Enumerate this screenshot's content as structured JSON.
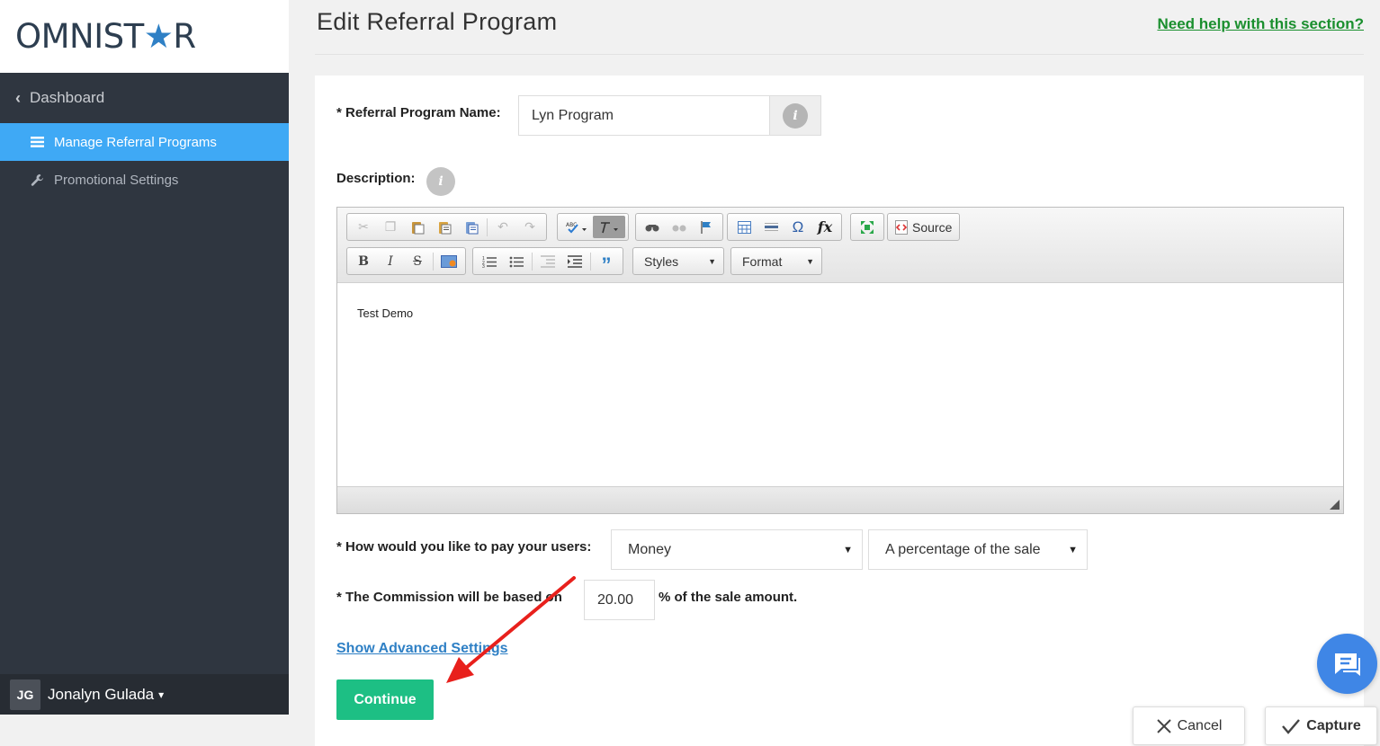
{
  "sidebar": {
    "logo_left": "OMNIST",
    "logo_star": "★",
    "logo_right": "R",
    "back_label": "Dashboard",
    "items": [
      {
        "label": "Manage Referral Programs",
        "active": true
      },
      {
        "label": "Promotional Settings",
        "active": false
      }
    ],
    "user": {
      "initials": "JG",
      "name": "Jonalyn Gulada"
    }
  },
  "header": {
    "title": "Edit Referral Program",
    "help_link": "Need help with this section?"
  },
  "form": {
    "name_label": "* Referral Program Name:",
    "name_value": "Lyn Program",
    "description_label": "Description:",
    "info_glyph": "i",
    "editor": {
      "source_label": "Source",
      "styles_label": "Styles",
      "format_label": "Format",
      "content": "Test Demo"
    },
    "pay_label": "* How would you like to pay your users:",
    "pay_method": "Money",
    "pay_type": "A percentage of the sale",
    "commission_label": "* The Commission will be based on",
    "commission_value": "20.00",
    "commission_suffix": "% of the sale amount.",
    "advanced_link": "Show Advanced Settings",
    "continue_label": "Continue"
  },
  "overlay": {
    "cancel_label": "Cancel",
    "capture_label": "Capture"
  },
  "colors": {
    "sidebar_bg": "#2f3640",
    "active_item": "#3fa9f5",
    "continue_btn": "#1dbf84",
    "help_link": "#1a8f2e",
    "annotation_arrow": "#e8201c"
  }
}
